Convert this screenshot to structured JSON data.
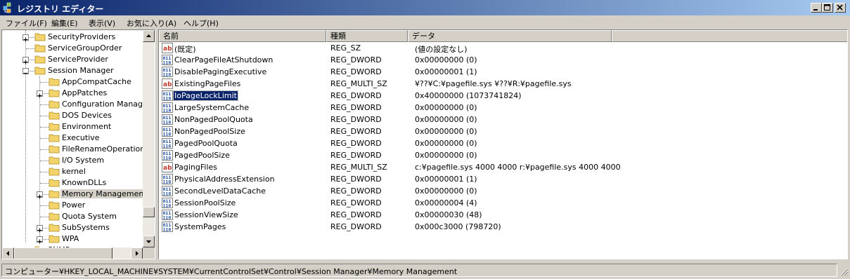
{
  "window": {
    "title": "レジストリ エディター",
    "controls": {
      "minimize": "minimize",
      "maximize": "maximize",
      "close": "close"
    }
  },
  "menu": [
    {
      "label": "ファイル(F)"
    },
    {
      "label": "編集(E)"
    },
    {
      "label": "表示(V)"
    },
    {
      "label": "お気に入り(A)"
    },
    {
      "label": "ヘルプ(H)"
    }
  ],
  "tree": [
    {
      "label": "SecurityProviders",
      "expander": "+",
      "depth": 0
    },
    {
      "label": "ServiceGroupOrder",
      "expander": "",
      "depth": 0
    },
    {
      "label": "ServiceProvider",
      "expander": "+",
      "depth": 0
    },
    {
      "label": "Session Manager",
      "expander": "-",
      "depth": 0
    },
    {
      "label": "AppCompatCache",
      "expander": "",
      "depth": 1
    },
    {
      "label": "AppPatches",
      "expander": "+",
      "depth": 1
    },
    {
      "label": "Configuration Manager",
      "expander": "",
      "depth": 1
    },
    {
      "label": "DOS Devices",
      "expander": "",
      "depth": 1
    },
    {
      "label": "Environment",
      "expander": "",
      "depth": 1
    },
    {
      "label": "Executive",
      "expander": "",
      "depth": 1
    },
    {
      "label": "FileRenameOperations",
      "expander": "",
      "depth": 1
    },
    {
      "label": "I/O System",
      "expander": "",
      "depth": 1
    },
    {
      "label": "kernel",
      "expander": "",
      "depth": 1
    },
    {
      "label": "KnownDLLs",
      "expander": "",
      "depth": 1
    },
    {
      "label": "Memory Management",
      "expander": "+",
      "depth": 1,
      "selected": true
    },
    {
      "label": "Power",
      "expander": "",
      "depth": 1
    },
    {
      "label": "Quota System",
      "expander": "",
      "depth": 1
    },
    {
      "label": "SubSystems",
      "expander": "+",
      "depth": 1
    },
    {
      "label": "WPA",
      "expander": "+",
      "depth": 1
    },
    {
      "label": "SNMP",
      "expander": "+",
      "depth": 0
    }
  ],
  "columns": {
    "name": "名前",
    "type": "種類",
    "data": "データ"
  },
  "values": [
    {
      "icon": "string-value-icon",
      "name": "(既定)",
      "type": "REG_SZ",
      "data": "(値の設定なし)"
    },
    {
      "icon": "binary-value-icon",
      "name": "ClearPageFileAtShutdown",
      "type": "REG_DWORD",
      "data": "0x00000000 (0)"
    },
    {
      "icon": "binary-value-icon",
      "name": "DisablePagingExecutive",
      "type": "REG_DWORD",
      "data": "0x00000001 (1)"
    },
    {
      "icon": "string-value-icon",
      "name": "ExistingPageFiles",
      "type": "REG_MULTI_SZ",
      "data": "¥??¥C:¥pagefile.sys ¥??¥R:¥pagefile.sys"
    },
    {
      "icon": "binary-value-icon",
      "name": "IoPageLockLimit",
      "type": "REG_DWORD",
      "data": "0x40000000 (1073741824)",
      "selected": true
    },
    {
      "icon": "binary-value-icon",
      "name": "LargeSystemCache",
      "type": "REG_DWORD",
      "data": "0x00000000 (0)"
    },
    {
      "icon": "binary-value-icon",
      "name": "NonPagedPoolQuota",
      "type": "REG_DWORD",
      "data": "0x00000000 (0)"
    },
    {
      "icon": "binary-value-icon",
      "name": "NonPagedPoolSize",
      "type": "REG_DWORD",
      "data": "0x00000000 (0)"
    },
    {
      "icon": "binary-value-icon",
      "name": "PagedPoolQuota",
      "type": "REG_DWORD",
      "data": "0x00000000 (0)"
    },
    {
      "icon": "binary-value-icon",
      "name": "PagedPoolSize",
      "type": "REG_DWORD",
      "data": "0x00000000 (0)"
    },
    {
      "icon": "string-value-icon",
      "name": "PagingFiles",
      "type": "REG_MULTI_SZ",
      "data": "c:¥pagefile.sys 4000 4000 r:¥pagefile.sys 4000 4000"
    },
    {
      "icon": "binary-value-icon",
      "name": "PhysicalAddressExtension",
      "type": "REG_DWORD",
      "data": "0x00000001 (1)"
    },
    {
      "icon": "binary-value-icon",
      "name": "SecondLevelDataCache",
      "type": "REG_DWORD",
      "data": "0x00000000 (0)"
    },
    {
      "icon": "binary-value-icon",
      "name": "SessionPoolSize",
      "type": "REG_DWORD",
      "data": "0x00000004 (4)"
    },
    {
      "icon": "binary-value-icon",
      "name": "SessionViewSize",
      "type": "REG_DWORD",
      "data": "0x00000030 (48)"
    },
    {
      "icon": "binary-value-icon",
      "name": "SystemPages",
      "type": "REG_DWORD",
      "data": "0x000c3000 (798720)"
    }
  ],
  "status": {
    "path": "コンピューター¥HKEY_LOCAL_MACHINE¥SYSTEM¥CurrentControlSet¥Control¥Session Manager¥Memory Management"
  },
  "colors": {
    "title_start": "#0a246a",
    "title_end": "#a6caf0",
    "selection": "#0a246a",
    "chrome": "#d4d0c8",
    "folder": "#f3d36b"
  }
}
